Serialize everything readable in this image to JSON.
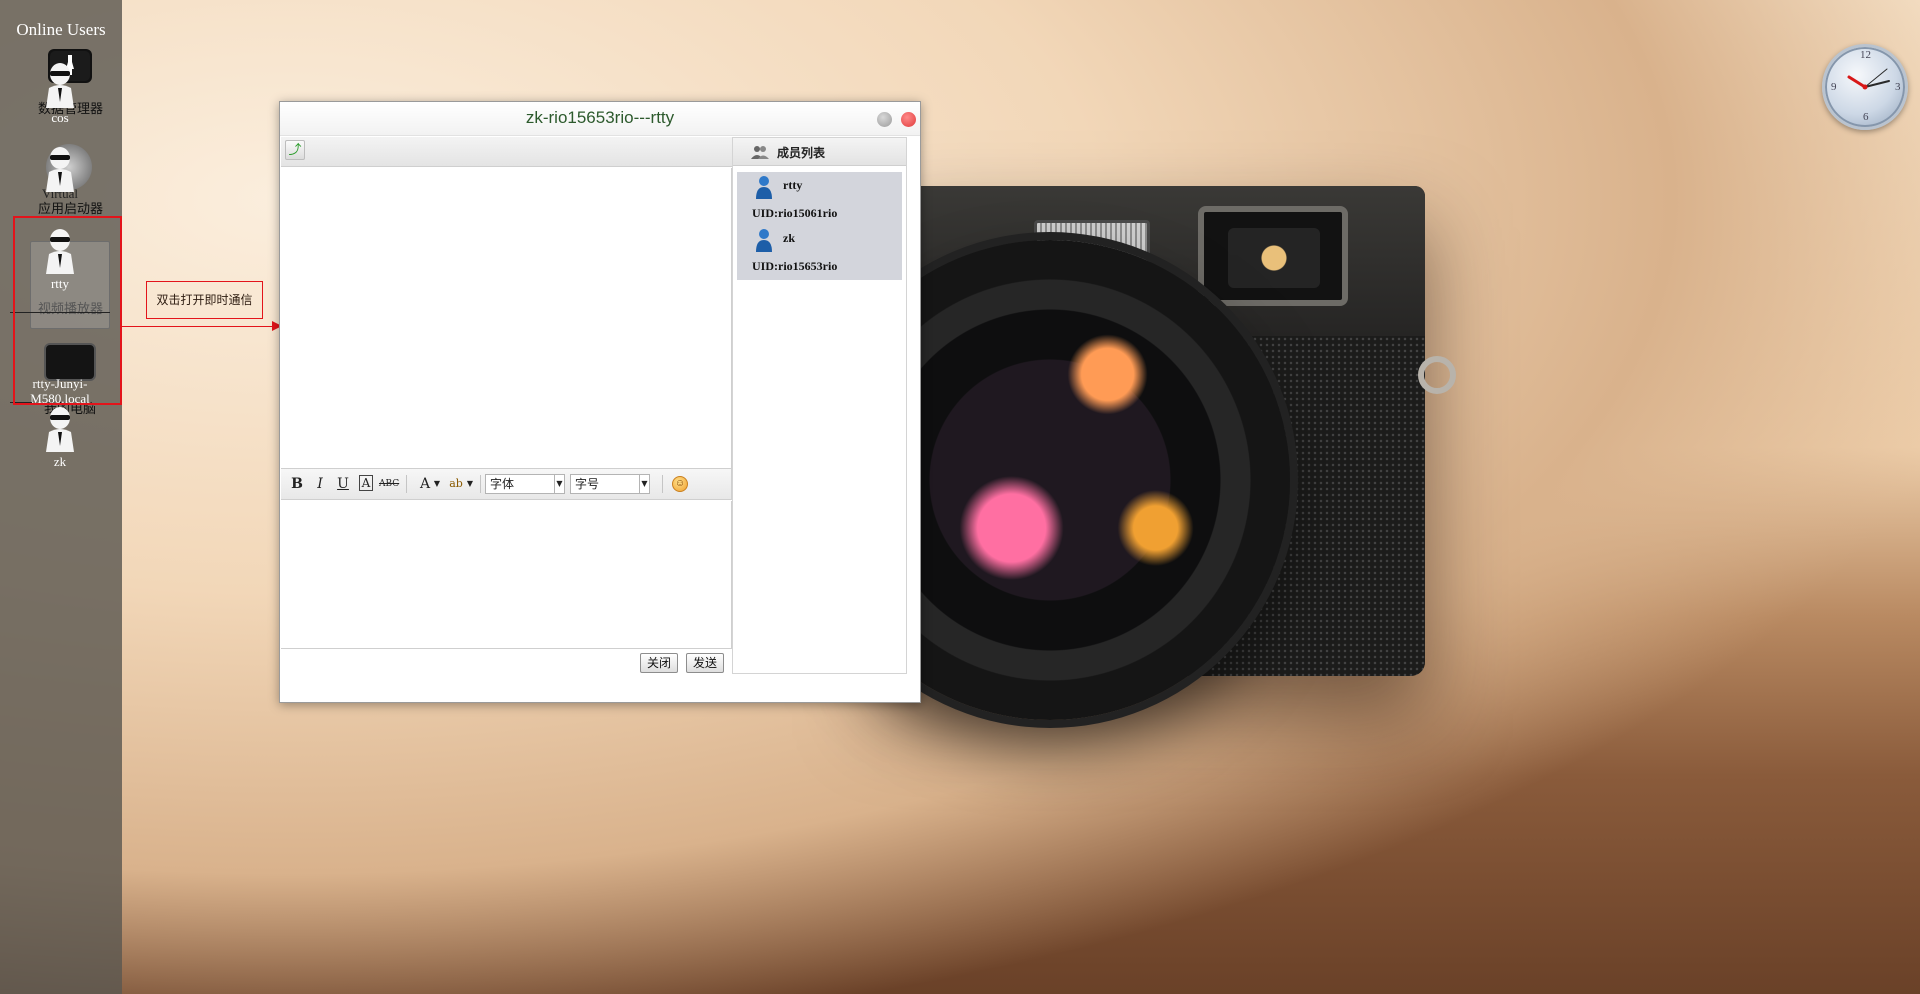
{
  "sidebar": {
    "title": "Online Users",
    "apps": [
      {
        "label": "数据管理器",
        "icon": "folder-app-icon"
      },
      {
        "label": "应用启动器",
        "icon": "launcher-app-icon"
      },
      {
        "label": "视频播放器",
        "icon": "video-player-app-icon"
      },
      {
        "label": "我的电脑",
        "icon": "computer-app-icon"
      }
    ],
    "apps_partial_labels": [
      "cos",
      "Virtual"
    ],
    "users": [
      {
        "label": "cos"
      },
      {
        "label": "Virtual"
      },
      {
        "label": "rtty"
      },
      {
        "label": "rtty-Junyi-M580.local"
      },
      {
        "label": "zk"
      }
    ]
  },
  "annotation": {
    "tooltip": "双击打开即时通信",
    "highlight_color": "#e3141b"
  },
  "clock": {
    "numbers": [
      "12",
      "3",
      "6",
      "9"
    ]
  },
  "chat": {
    "title": "zk-rio15653rio---rtty",
    "toolbar": {
      "font_placeholder": "字体",
      "size_placeholder": "字号",
      "bold": "B",
      "italic": "I",
      "underline": "U",
      "border_a": "A",
      "strike": "ABC",
      "font_color": "A",
      "highlight": "ab"
    },
    "buttons": {
      "close": "关闭",
      "send": "发送"
    },
    "members": {
      "header": "成员列表",
      "list": [
        {
          "name": "rtty",
          "uid": "UID:rio15061rio"
        },
        {
          "name": "zk",
          "uid": "UID:rio15653rio"
        }
      ]
    }
  },
  "colors": {
    "sidebar_bg": "#5c5850",
    "title_text": "#2d5a2d",
    "member_list_bg": "#d3d5dc",
    "close_button": "#e03b3b"
  }
}
